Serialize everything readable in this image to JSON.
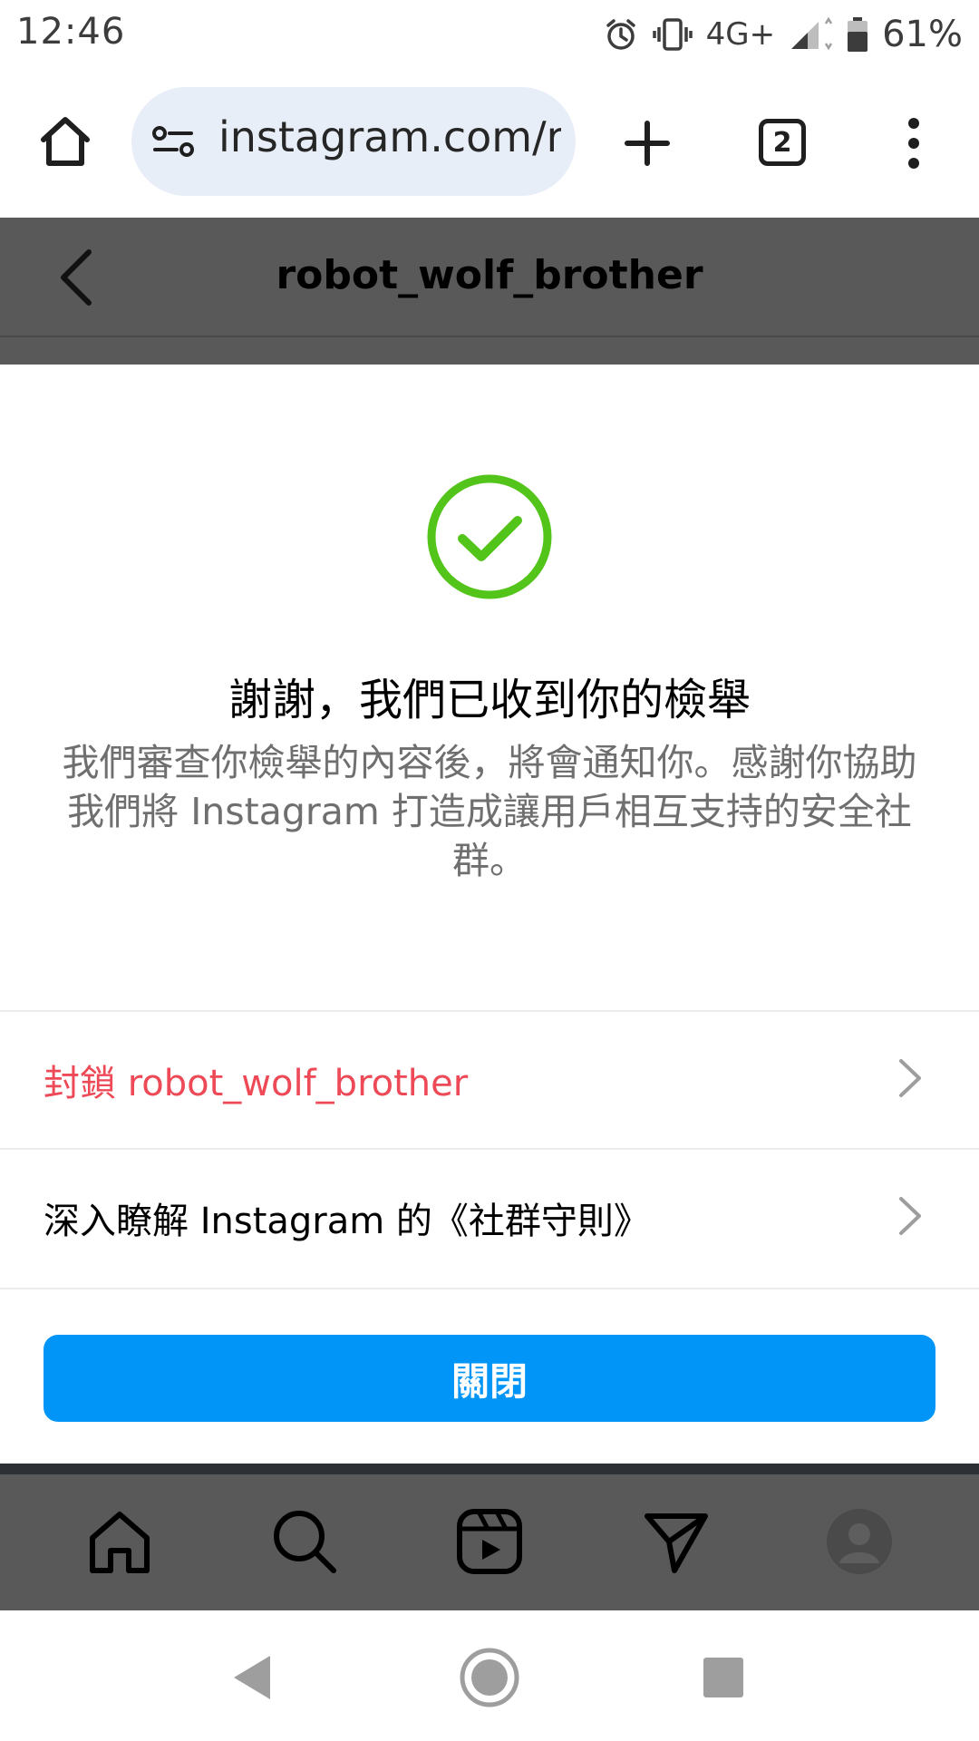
{
  "status_bar": {
    "time": "12:46",
    "network": "4G+",
    "battery": "61%"
  },
  "browser": {
    "url": "instagram.com/robot_wolf_brother",
    "tab_count": "2"
  },
  "header": {
    "title": "robot_wolf_brother"
  },
  "report_sheet": {
    "title": "謝謝，我們已收到你的檢舉",
    "description": "我們審查你檢舉的內容後，將會通知你。感謝你協助我們將 Instagram 打造成讓用戶相互支持的安全社群。",
    "options": [
      {
        "label": "封鎖 robot_wolf_brother",
        "style": "danger"
      },
      {
        "label": "深入瞭解 Instagram 的《社群守則》",
        "style": "normal"
      }
    ],
    "close_label": "關閉"
  },
  "colors": {
    "success_green": "#52c41a",
    "danger_red": "#ed4956",
    "button_blue": "#0095f6"
  },
  "icons": [
    "home-icon",
    "search-icon",
    "reels-icon",
    "direct-message-icon",
    "profile-avatar-icon"
  ]
}
